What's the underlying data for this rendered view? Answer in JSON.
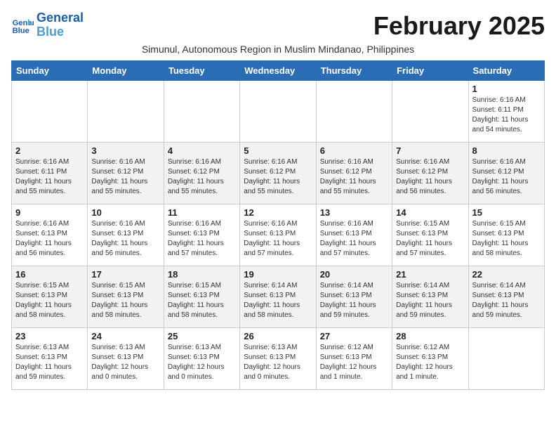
{
  "header": {
    "logo_line1": "General",
    "logo_line2": "Blue",
    "month_title": "February 2025",
    "subtitle": "Simunul, Autonomous Region in Muslim Mindanao, Philippines"
  },
  "days_of_week": [
    "Sunday",
    "Monday",
    "Tuesday",
    "Wednesday",
    "Thursday",
    "Friday",
    "Saturday"
  ],
  "weeks": [
    [
      {
        "day": "",
        "info": ""
      },
      {
        "day": "",
        "info": ""
      },
      {
        "day": "",
        "info": ""
      },
      {
        "day": "",
        "info": ""
      },
      {
        "day": "",
        "info": ""
      },
      {
        "day": "",
        "info": ""
      },
      {
        "day": "1",
        "info": "Sunrise: 6:16 AM\nSunset: 6:11 PM\nDaylight: 11 hours\nand 54 minutes."
      }
    ],
    [
      {
        "day": "2",
        "info": "Sunrise: 6:16 AM\nSunset: 6:11 PM\nDaylight: 11 hours\nand 55 minutes."
      },
      {
        "day": "3",
        "info": "Sunrise: 6:16 AM\nSunset: 6:12 PM\nDaylight: 11 hours\nand 55 minutes."
      },
      {
        "day": "4",
        "info": "Sunrise: 6:16 AM\nSunset: 6:12 PM\nDaylight: 11 hours\nand 55 minutes."
      },
      {
        "day": "5",
        "info": "Sunrise: 6:16 AM\nSunset: 6:12 PM\nDaylight: 11 hours\nand 55 minutes."
      },
      {
        "day": "6",
        "info": "Sunrise: 6:16 AM\nSunset: 6:12 PM\nDaylight: 11 hours\nand 55 minutes."
      },
      {
        "day": "7",
        "info": "Sunrise: 6:16 AM\nSunset: 6:12 PM\nDaylight: 11 hours\nand 56 minutes."
      },
      {
        "day": "8",
        "info": "Sunrise: 6:16 AM\nSunset: 6:12 PM\nDaylight: 11 hours\nand 56 minutes."
      }
    ],
    [
      {
        "day": "9",
        "info": "Sunrise: 6:16 AM\nSunset: 6:13 PM\nDaylight: 11 hours\nand 56 minutes."
      },
      {
        "day": "10",
        "info": "Sunrise: 6:16 AM\nSunset: 6:13 PM\nDaylight: 11 hours\nand 56 minutes."
      },
      {
        "day": "11",
        "info": "Sunrise: 6:16 AM\nSunset: 6:13 PM\nDaylight: 11 hours\nand 57 minutes."
      },
      {
        "day": "12",
        "info": "Sunrise: 6:16 AM\nSunset: 6:13 PM\nDaylight: 11 hours\nand 57 minutes."
      },
      {
        "day": "13",
        "info": "Sunrise: 6:16 AM\nSunset: 6:13 PM\nDaylight: 11 hours\nand 57 minutes."
      },
      {
        "day": "14",
        "info": "Sunrise: 6:15 AM\nSunset: 6:13 PM\nDaylight: 11 hours\nand 57 minutes."
      },
      {
        "day": "15",
        "info": "Sunrise: 6:15 AM\nSunset: 6:13 PM\nDaylight: 11 hours\nand 58 minutes."
      }
    ],
    [
      {
        "day": "16",
        "info": "Sunrise: 6:15 AM\nSunset: 6:13 PM\nDaylight: 11 hours\nand 58 minutes."
      },
      {
        "day": "17",
        "info": "Sunrise: 6:15 AM\nSunset: 6:13 PM\nDaylight: 11 hours\nand 58 minutes."
      },
      {
        "day": "18",
        "info": "Sunrise: 6:15 AM\nSunset: 6:13 PM\nDaylight: 11 hours\nand 58 minutes."
      },
      {
        "day": "19",
        "info": "Sunrise: 6:14 AM\nSunset: 6:13 PM\nDaylight: 11 hours\nand 58 minutes."
      },
      {
        "day": "20",
        "info": "Sunrise: 6:14 AM\nSunset: 6:13 PM\nDaylight: 11 hours\nand 59 minutes."
      },
      {
        "day": "21",
        "info": "Sunrise: 6:14 AM\nSunset: 6:13 PM\nDaylight: 11 hours\nand 59 minutes."
      },
      {
        "day": "22",
        "info": "Sunrise: 6:14 AM\nSunset: 6:13 PM\nDaylight: 11 hours\nand 59 minutes."
      }
    ],
    [
      {
        "day": "23",
        "info": "Sunrise: 6:13 AM\nSunset: 6:13 PM\nDaylight: 11 hours\nand 59 minutes."
      },
      {
        "day": "24",
        "info": "Sunrise: 6:13 AM\nSunset: 6:13 PM\nDaylight: 12 hours\nand 0 minutes."
      },
      {
        "day": "25",
        "info": "Sunrise: 6:13 AM\nSunset: 6:13 PM\nDaylight: 12 hours\nand 0 minutes."
      },
      {
        "day": "26",
        "info": "Sunrise: 6:13 AM\nSunset: 6:13 PM\nDaylight: 12 hours\nand 0 minutes."
      },
      {
        "day": "27",
        "info": "Sunrise: 6:12 AM\nSunset: 6:13 PM\nDaylight: 12 hours\nand 1 minute."
      },
      {
        "day": "28",
        "info": "Sunrise: 6:12 AM\nSunset: 6:13 PM\nDaylight: 12 hours\nand 1 minute."
      },
      {
        "day": "",
        "info": ""
      }
    ]
  ]
}
